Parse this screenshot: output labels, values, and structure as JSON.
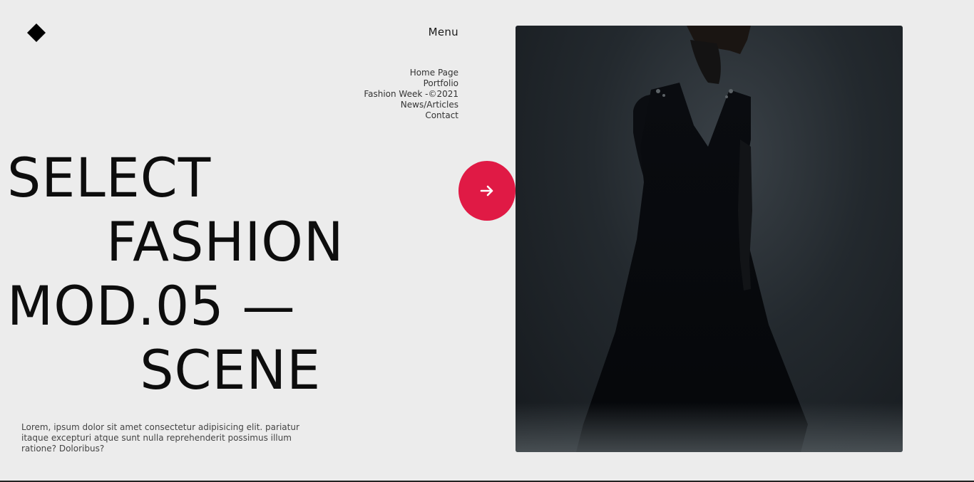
{
  "header": {
    "logo_icon": "diamond-logo-icon",
    "menu_label": "Menu"
  },
  "nav": {
    "items": [
      {
        "label": "Home Page"
      },
      {
        "label": "Portfolio"
      },
      {
        "label": "Fashion Week -©2021"
      },
      {
        "label": "News/Articles"
      },
      {
        "label": "Contact"
      }
    ]
  },
  "hero": {
    "line1": "SELECT",
    "line2": "FASHION",
    "line3": "MOD.05 —",
    "line4": "SCENE"
  },
  "description": "Lorem, ipsum dolor sit amet consectetur adipisicing elit. pariatur itaque excepturi atque sunt nulla reprehenderit possimus illum ratione? Doloribus?",
  "cta": {
    "icon": "arrow-right-icon",
    "color": "#e01a45"
  },
  "photo": {
    "subject": "fashion-model-photo"
  },
  "colors": {
    "background": "#ececec",
    "accent": "#e01a45",
    "text": "#0d0d0d"
  }
}
